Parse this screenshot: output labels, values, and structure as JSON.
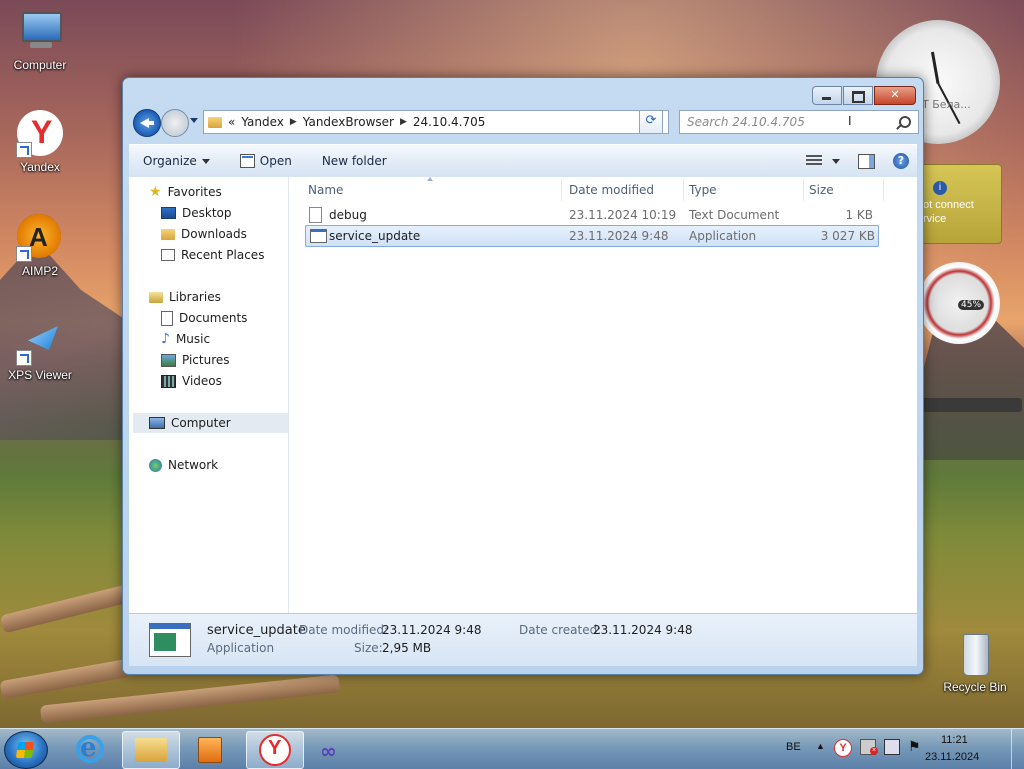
{
  "desktop": {
    "icons": [
      {
        "label": "Computer"
      },
      {
        "label": "Yandex"
      },
      {
        "label": "AIMP2"
      },
      {
        "label": "XPS Viewer"
      },
      {
        "label": "Recycle Bin"
      }
    ],
    "weather_gadget": {
      "line1": "ot connect",
      "line2": "rvice"
    },
    "clock_gadget": {
      "label": "Т Бела..."
    },
    "meter_gadget": {
      "value": "45%"
    }
  },
  "window": {
    "address": {
      "prefix": "«",
      "crumbs": [
        "Yandex",
        "YandexBrowser",
        "24.10.4.705"
      ]
    },
    "search": {
      "placeholder": "Search 24.10.4.705"
    },
    "toolbar": {
      "organize": "Organize",
      "open": "Open",
      "new_folder": "New folder"
    },
    "nav": {
      "favorites": {
        "label": "Favorites",
        "items": [
          "Desktop",
          "Downloads",
          "Recent Places"
        ]
      },
      "libraries": {
        "label": "Libraries",
        "items": [
          "Documents",
          "Music",
          "Pictures",
          "Videos"
        ]
      },
      "computer": "Computer",
      "network": "Network"
    },
    "columns": [
      "Name",
      "Date modified",
      "Type",
      "Size"
    ],
    "files": [
      {
        "name": "debug",
        "date": "23.11.2024 10:19",
        "type": "Text Document",
        "size": "1 KB"
      },
      {
        "name": "service_update",
        "date": "23.11.2024 9:48",
        "type": "Application",
        "size": "3 027 KB"
      }
    ],
    "details": {
      "name": "service_update",
      "type": "Application",
      "date_modified_label": "Date modified:",
      "date_modified": "23.11.2024 9:48",
      "size_label": "Size:",
      "size": "2,95 MB",
      "date_created_label": "Date created:",
      "date_created": "23.11.2024 9:48"
    }
  },
  "taskbar": {
    "language": "BE",
    "time": "11:21",
    "date": "23.11.2024"
  },
  "colors": {
    "accent": "#3a6fbf",
    "selection": "#cfe2f7"
  }
}
